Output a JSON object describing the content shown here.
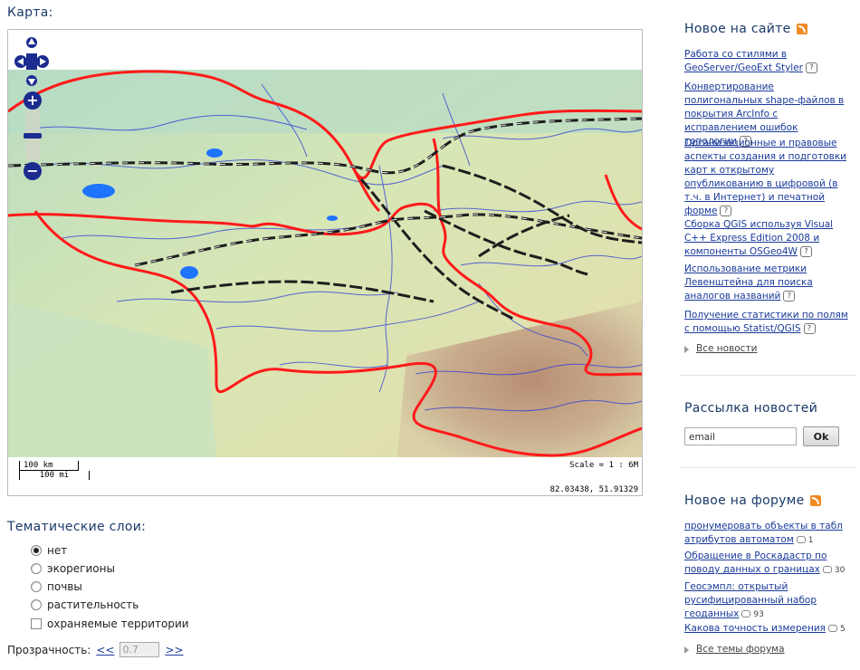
{
  "map": {
    "title": "Карта:",
    "zoom_in_label": "+",
    "zoom_out_label": "−",
    "scale_km": "100 km",
    "scale_mi": "100 mi",
    "scale_text": "Scale = 1 : 6M",
    "coords": "82.03438, 51.91329"
  },
  "layers": {
    "title": "Тематические слои:",
    "items": [
      {
        "label": "нет",
        "selected": true
      },
      {
        "label": "экорегионы",
        "selected": false
      },
      {
        "label": "почвы",
        "selected": false
      },
      {
        "label": "растительность",
        "selected": false
      }
    ],
    "protected": {
      "label": "охраняемые территории",
      "checked": false
    }
  },
  "opacity": {
    "label": "Прозрачность:",
    "prev": "<<",
    "value": "0.7",
    "next": ">>"
  },
  "news": {
    "title": "Новое на сайте",
    "items": [
      "Работа со стилями в GeoServer/GeoExt Styler",
      "Конвертирование полигональных shape-файлов в покрытия ArcInfo с исправлением ошибок топологии",
      "Организационные и правовые аспекты создания и подготовки карт к открытому опубликованию в цифровой (в т.ч. в Интернет) и печатной форме",
      "Сборка QGIS используя Visual C++ Express Edition 2008 и компоненты OSGeo4W",
      "Использование метрики Левенштейна для поиска аналогов названий",
      "Получение статистики по полям с помощью Statist/QGIS"
    ],
    "all": "Все новости"
  },
  "newsletter": {
    "title": "Рассылка новостей",
    "email_value": "email",
    "ok": "Ok"
  },
  "forum": {
    "title": "Новое на форуме",
    "items": [
      {
        "text": "пронумеровать объекты в табл атрибутов автоматом",
        "count": "1"
      },
      {
        "text": "Обращение в Роскадастр по поводу данных о границах",
        "count": "30"
      },
      {
        "text": "Геосэмпл: открытый русифицированный набор геоданных",
        "count": "93"
      },
      {
        "text": "Какова точность измерения",
        "count": "5"
      }
    ],
    "all": "Все темы форума"
  },
  "colors": {
    "accent": "#1a3a9a",
    "boundary": "#ff1a1a",
    "rivers": "#2a3ad8",
    "roads": "#222222"
  }
}
